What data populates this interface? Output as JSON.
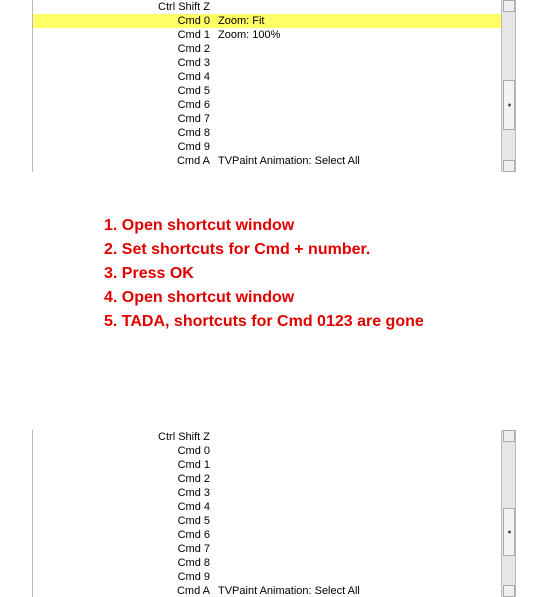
{
  "pane_before": {
    "rows": [
      {
        "shortcut": "Ctrl Shift Z",
        "action": "",
        "highlight": false
      },
      {
        "shortcut": "Cmd 0",
        "action": "Zoom: Fit",
        "highlight": true
      },
      {
        "shortcut": "Cmd 1",
        "action": "Zoom: 100%",
        "highlight": false
      },
      {
        "shortcut": "Cmd 2",
        "action": "",
        "highlight": false
      },
      {
        "shortcut": "Cmd 3",
        "action": "",
        "highlight": false
      },
      {
        "shortcut": "Cmd 4",
        "action": "",
        "highlight": false
      },
      {
        "shortcut": "Cmd 5",
        "action": "",
        "highlight": false
      },
      {
        "shortcut": "Cmd 6",
        "action": "",
        "highlight": false
      },
      {
        "shortcut": "Cmd 7",
        "action": "",
        "highlight": false
      },
      {
        "shortcut": "Cmd 8",
        "action": "",
        "highlight": false
      },
      {
        "shortcut": "Cmd 9",
        "action": "",
        "highlight": false
      },
      {
        "shortcut": "Cmd A",
        "action": "TVPaint Animation: Select All",
        "highlight": false
      }
    ]
  },
  "instructions": {
    "step1": "1. Open shortcut window",
    "step2": "2. Set shortcuts for Cmd + number.",
    "step3": "3. Press OK",
    "step4": "4. Open shortcut window",
    "step5": "5. TADA, shortcuts for Cmd 0123 are gone"
  },
  "pane_after": {
    "rows": [
      {
        "shortcut": "Ctrl Shift Z",
        "action": "",
        "highlight": false
      },
      {
        "shortcut": "Cmd 0",
        "action": "",
        "highlight": false
      },
      {
        "shortcut": "Cmd 1",
        "action": "",
        "highlight": false
      },
      {
        "shortcut": "Cmd 2",
        "action": "",
        "highlight": false
      },
      {
        "shortcut": "Cmd 3",
        "action": "",
        "highlight": false
      },
      {
        "shortcut": "Cmd 4",
        "action": "",
        "highlight": false
      },
      {
        "shortcut": "Cmd 5",
        "action": "",
        "highlight": false
      },
      {
        "shortcut": "Cmd 6",
        "action": "",
        "highlight": false
      },
      {
        "shortcut": "Cmd 7",
        "action": "",
        "highlight": false
      },
      {
        "shortcut": "Cmd 8",
        "action": "",
        "highlight": false
      },
      {
        "shortcut": "Cmd 9",
        "action": "",
        "highlight": false
      },
      {
        "shortcut": "Cmd A",
        "action": "TVPaint Animation: Select All",
        "highlight": false
      }
    ]
  }
}
